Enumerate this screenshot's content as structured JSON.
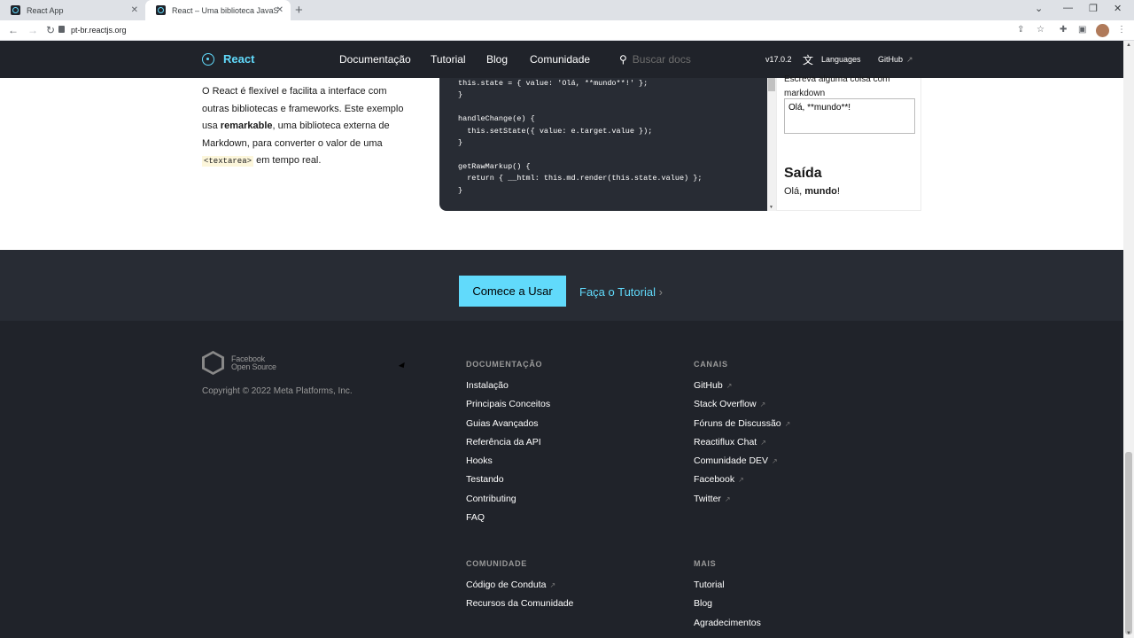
{
  "browser": {
    "tabs": [
      {
        "title": "React App",
        "active": false
      },
      {
        "title": "React – Uma biblioteca JavaScript",
        "active": true
      }
    ],
    "url": "pt-br.reactjs.org"
  },
  "header": {
    "brand": "React",
    "nav": [
      "Documentação",
      "Tutorial",
      "Blog",
      "Comunidade"
    ],
    "search_placeholder": "Buscar docs",
    "version": "v17.0.2",
    "languages": "Languages",
    "github": "GitHub"
  },
  "example": {
    "desc_part1": "O React é flexível e facilita a interface com outras bibliotecas e frameworks. Este exemplo usa ",
    "desc_bold": "remarkable",
    "desc_part2": ", uma biblioteca externa de Markdown, para converter o valor de uma ",
    "desc_code": "<textarea>",
    "desc_part3": " em tempo real.",
    "code_lines": [
      "this.state = { value: 'Olá, **mundo**!' };",
      "}",
      "",
      "handleChange(e) {",
      "  this.setState({ value: e.target.value });",
      "}",
      "",
      "getRawMarkup() {",
      "  return { __html: this.md.render(this.state.value) };",
      "}"
    ],
    "prompt": "Escreva alguma coisa com markdown",
    "textarea_value": "Olá, **mundo**!",
    "output_title": "Saída",
    "output_plain": "Olá, ",
    "output_bold": "mundo",
    "output_end": "!"
  },
  "cta": {
    "primary": "Comece a Usar",
    "secondary": "Faça o Tutorial",
    "secondary_arrow": "›"
  },
  "footer": {
    "logo_line1": "Facebook",
    "logo_line2": "Open Source",
    "copyright": "Copyright © 2022 Meta Platforms, Inc.",
    "documentacao": {
      "title": "DOCUMENTAÇÃO",
      "items": [
        "Instalação",
        "Principais Conceitos",
        "Guias Avançados",
        "Referência da API",
        "Hooks",
        "Testando",
        "Contributing",
        "FAQ"
      ]
    },
    "canais": {
      "title": "CANAIS",
      "items": [
        "GitHub",
        "Stack Overflow",
        "Fóruns de Discussão",
        "Reactiflux Chat",
        "Comunidade DEV",
        "Facebook",
        "Twitter"
      ]
    },
    "comunidade": {
      "title": "COMUNIDADE",
      "items": [
        "Código de Conduta",
        "Recursos da Comunidade"
      ]
    },
    "mais": {
      "title": "MAIS",
      "items": [
        "Tutorial",
        "Blog",
        "Agradecimentos"
      ]
    }
  }
}
